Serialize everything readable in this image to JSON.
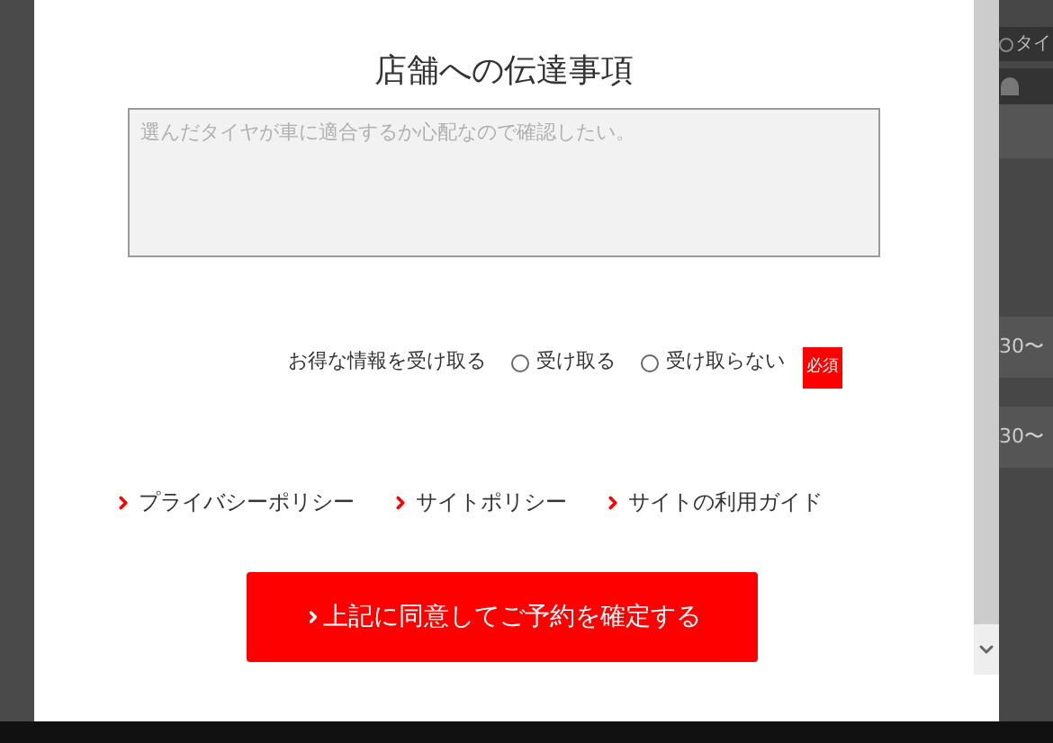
{
  "background": {
    "menu_items": [
      {
        "label": "タイ"
      }
    ],
    "rows": [
      {
        "time": "30〜"
      },
      {
        "time": "30〜"
      }
    ]
  },
  "dialog": {
    "title": "店舗への伝達事項",
    "message_field": {
      "placeholder": "選んだタイヤが車に適合するか心配なので確認したい。"
    },
    "newsletter": {
      "label": "お得な情報を受け取る",
      "options": [
        {
          "label": "受け取る",
          "selected": false
        },
        {
          "label": "受け取らない",
          "selected": false
        }
      ],
      "required_badge": "必須"
    },
    "links": [
      {
        "label": "プライバシーポリシー"
      },
      {
        "label": "サイトポリシー"
      },
      {
        "label": "サイトの利用ガイド"
      }
    ],
    "submit_button": "上記に同意してご予約を確定する"
  }
}
